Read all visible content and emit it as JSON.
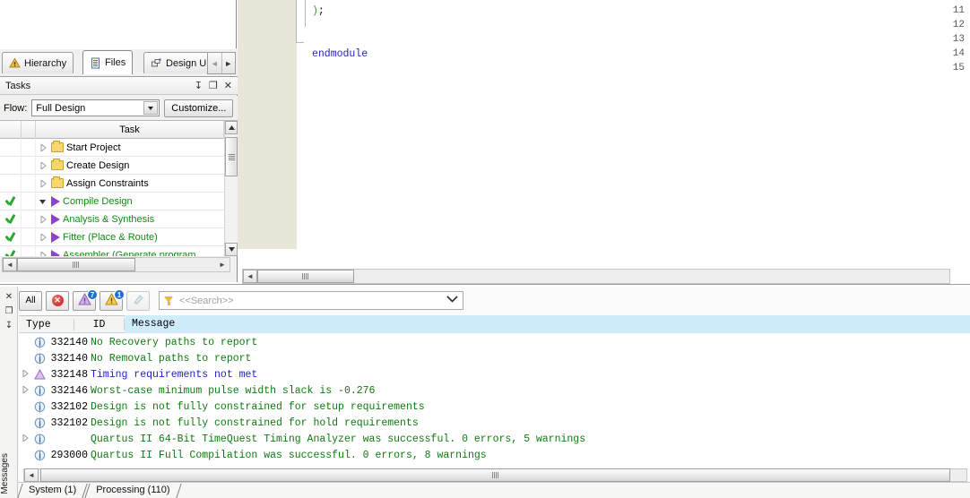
{
  "navigator": {
    "tabs": [
      {
        "label": "Hierarchy",
        "icon": "hierarchy-icon",
        "active": false
      },
      {
        "label": "Files",
        "icon": "files-icon",
        "active": true
      },
      {
        "label": "Design Un",
        "icon": "design-units-icon",
        "active": false
      }
    ],
    "scroll_left": "◄",
    "scroll_right": "►"
  },
  "tasks": {
    "title": "Tasks",
    "window_buttons": [
      "pin",
      "restore",
      "close"
    ],
    "pin_glyph": "↧",
    "restore_glyph": "❐",
    "close_glyph": "✕",
    "flow_label": "Flow:",
    "flow_value": "Full Design",
    "customize_label": "Customize...",
    "column_header": "Task",
    "rows": [
      {
        "label": "Start Project",
        "icon": "folder-icon",
        "done": false,
        "expander": "collapsed",
        "indent": 0,
        "green": false
      },
      {
        "label": "Create Design",
        "icon": "folder-icon",
        "done": false,
        "expander": "collapsed",
        "indent": 0,
        "green": false
      },
      {
        "label": "Assign Constraints",
        "icon": "folder-icon",
        "done": false,
        "expander": "collapsed",
        "indent": 0,
        "green": false
      },
      {
        "label": "Compile Design",
        "icon": "play-icon",
        "done": true,
        "expander": "expanded",
        "indent": 0,
        "green": true
      },
      {
        "label": "Analysis & Synthesis",
        "icon": "play-icon",
        "done": true,
        "expander": "collapsed",
        "indent": 1,
        "green": true
      },
      {
        "label": "Fitter (Place & Route)",
        "icon": "play-icon",
        "done": true,
        "expander": "collapsed",
        "indent": 1,
        "green": true
      },
      {
        "label": "Assembler (Generate program",
        "icon": "play-icon",
        "done": true,
        "expander": "collapsed",
        "indent": 1,
        "green": true
      }
    ]
  },
  "editor": {
    "lines": [
      {
        "num": "11",
        "text": ");"
      },
      {
        "num": "12",
        "text": ""
      },
      {
        "num": "13",
        "text": ""
      },
      {
        "num": "14",
        "text": "endmodule"
      },
      {
        "num": "15",
        "text": ""
      }
    ]
  },
  "messages": {
    "sidebar_label": "Messages",
    "sidebar_icons": [
      "close-icon",
      "restore-icon",
      "pin-icon"
    ],
    "close_glyph": "✕",
    "restore_glyph": "❐",
    "pin_glyph": "↧",
    "toolbar": {
      "all_label": "All",
      "error_glyph": "✕",
      "critical_badge": "7",
      "warning_badge": "1",
      "info_glyph": ""
    },
    "search_placeholder": "<<Search>>",
    "dropdown_glyph": "⌄",
    "columns": {
      "type": "Type",
      "id": "ID",
      "message": "Message"
    },
    "rows": [
      {
        "icon": "info-icon",
        "expander": false,
        "id": "332140",
        "text": "No Recovery paths to report",
        "color": "green"
      },
      {
        "icon": "info-icon",
        "expander": false,
        "id": "332140",
        "text": "No Removal paths to report",
        "color": "green"
      },
      {
        "icon": "critical-warning-icon",
        "expander": true,
        "id": "332148",
        "text": "Timing requirements not met",
        "color": "blue"
      },
      {
        "icon": "info-icon",
        "expander": true,
        "id": "332146",
        "text": "Worst-case minimum pulse width slack is -0.276",
        "color": "green"
      },
      {
        "icon": "info-icon",
        "expander": false,
        "id": "332102",
        "text": "Design is not fully constrained for setup requirements",
        "color": "green"
      },
      {
        "icon": "info-icon",
        "expander": false,
        "id": "332102",
        "text": "Design is not fully constrained for hold requirements",
        "color": "green"
      },
      {
        "icon": "info-icon",
        "expander": true,
        "id": "",
        "text": "Quartus II 64-Bit TimeQuest Timing Analyzer was successful. 0 errors, 5 warnings",
        "color": "green"
      },
      {
        "icon": "info-icon",
        "expander": false,
        "id": "293000",
        "text": "Quartus II Full Compilation was successful. 0 errors, 8 warnings",
        "color": "green"
      }
    ],
    "tabs": [
      {
        "label": "System (1)"
      },
      {
        "label": "Processing (110)"
      }
    ]
  },
  "scroll": {
    "left_arrow": "◄",
    "right_arrow": "►",
    "up_arrow": "▲",
    "down_arrow": "▼"
  },
  "colors": {
    "info_text": "#0f7a0f",
    "warning_text": "#2121cc",
    "header_highlight": "#cfecfa",
    "folder": "#f5d76e",
    "play": "#8e44c8",
    "check": "#2aa82a"
  }
}
